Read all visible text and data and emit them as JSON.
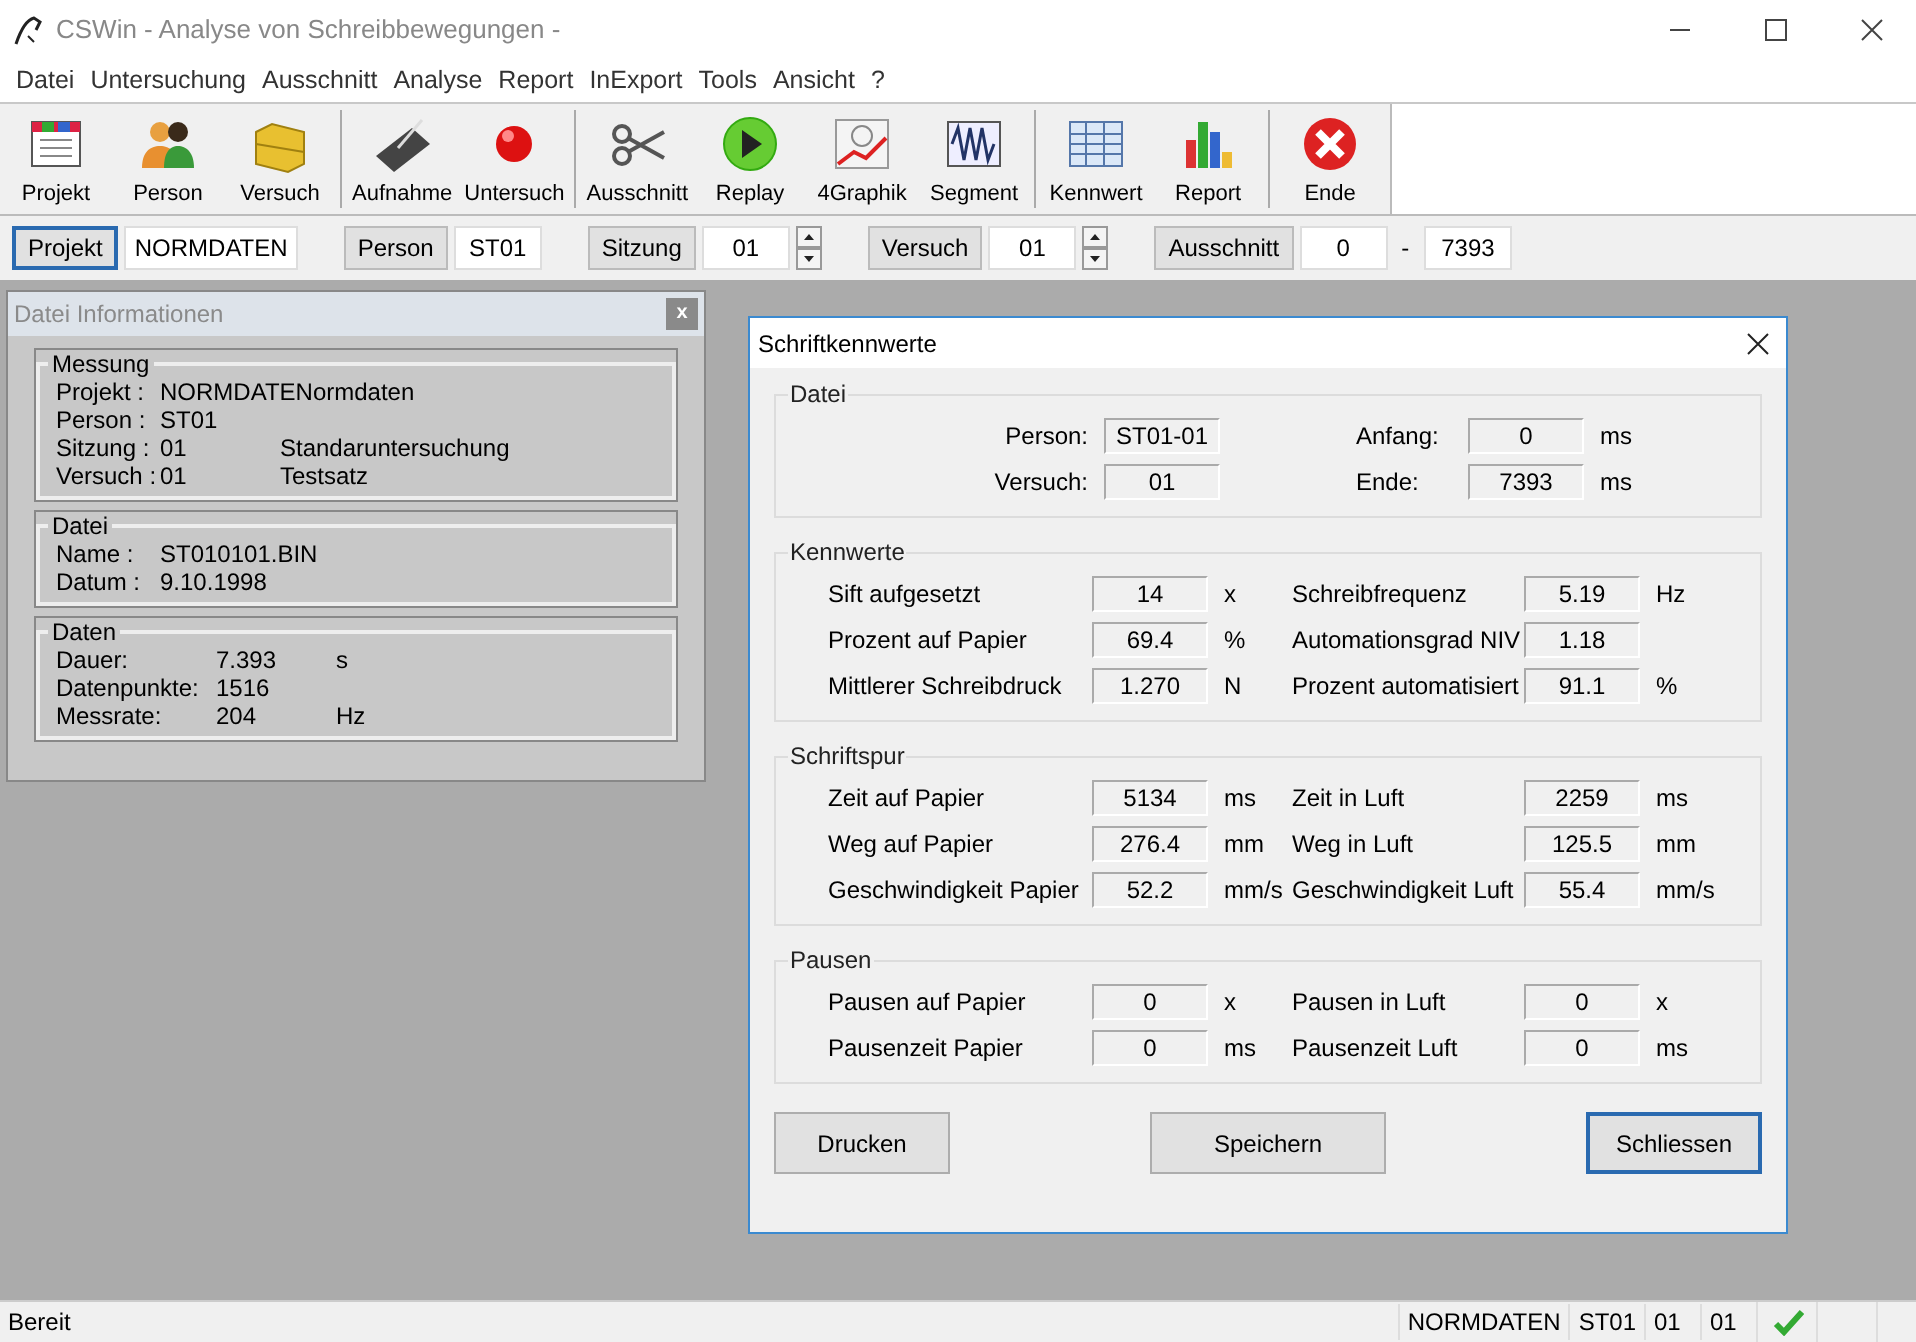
{
  "window": {
    "title": "CSWin - Analyse von Schreibbewegungen -"
  },
  "menu": [
    "Datei",
    "Untersuchung",
    "Ausschnitt",
    "Analyse",
    "Report",
    "InExport",
    "Tools",
    "Ansicht",
    "?"
  ],
  "toolbar": [
    [
      {
        "label": "Projekt",
        "kind": "document"
      },
      {
        "label": "Person",
        "kind": "people"
      },
      {
        "label": "Versuch",
        "kind": "folder"
      }
    ],
    [
      {
        "label": "Aufnahme",
        "kind": "tablet"
      },
      {
        "label": "Untersuch",
        "kind": "record"
      }
    ],
    [
      {
        "label": "Ausschnitt",
        "kind": "scissors"
      },
      {
        "label": "Replay",
        "kind": "play"
      },
      {
        "label": "4Graphik",
        "kind": "graph"
      },
      {
        "label": "Segment",
        "kind": "wave"
      }
    ],
    [
      {
        "label": "Kennwert",
        "kind": "table"
      },
      {
        "label": "Report",
        "kind": "bars"
      }
    ],
    [
      {
        "label": "Ende",
        "kind": "close"
      }
    ]
  ],
  "selector_bar": [
    {
      "button": "Projekt",
      "value": "NORMDATEN",
      "kind": "plain",
      "focused": true
    },
    {
      "button": "Person",
      "value": "ST01",
      "kind": "plain",
      "focused": false
    },
    {
      "button": "Sitzung",
      "value": "01",
      "kind": "spinner",
      "focused": false
    },
    {
      "button": "Versuch",
      "value": "01",
      "kind": "spinner",
      "focused": false
    },
    {
      "button": "Ausschnitt",
      "value": "0",
      "separator": "-",
      "value_end": "7393",
      "kind": "range",
      "focused": false
    }
  ],
  "info_panel": {
    "title": "Datei Informationen",
    "close": "x",
    "groups": [
      {
        "title": "Messung",
        "rows": [
          [
            "Projekt :",
            "NORMDATENormdaten"
          ],
          [
            "Person :",
            "ST01"
          ],
          [
            "Sitzung :",
            "01",
            "Standaruntersuchung"
          ],
          [
            "Versuch :",
            "01",
            "Testsatz"
          ]
        ]
      },
      {
        "title": "Datei",
        "rows": [
          [
            "Name :",
            "ST010101.BIN"
          ],
          [
            "Datum :",
            "9.10.1998"
          ]
        ]
      },
      {
        "title": "Daten",
        "rows": [
          [
            "Dauer:",
            "7.393",
            "s"
          ],
          [
            "Datenpunkte:",
            "1516"
          ],
          [
            "Messrate:",
            "204",
            "Hz"
          ]
        ]
      }
    ]
  },
  "dialog": {
    "title": "Schriftkennwerte",
    "sections": [
      {
        "title": "Datei",
        "kind": "compact",
        "rows": [
          [
            {
              "label": "Person:",
              "value": "ST01-01"
            },
            {
              "label": "Anfang:",
              "value": "0",
              "unit": "ms"
            }
          ],
          [
            {
              "label": "Versuch:",
              "value": "01"
            },
            {
              "label": "Ende:",
              "value": "7393",
              "unit": "ms"
            }
          ]
        ]
      },
      {
        "title": "Kennwerte",
        "kind": "wide",
        "rows": [
          [
            {
              "label": "Sift aufgesetzt",
              "value": "14",
              "unit": "x"
            },
            {
              "label": "Schreibfrequenz",
              "value": "5.19",
              "unit": "Hz"
            }
          ],
          [
            {
              "label": "Prozent auf Papier",
              "value": "69.4",
              "unit": "%"
            },
            {
              "label": "Automationsgrad NIV",
              "value": "1.18"
            }
          ],
          [
            {
              "label": "Mittlerer Schreibdruck",
              "value": "1.270",
              "unit": "N"
            },
            {
              "label": "Prozent automatisiert",
              "value": "91.1",
              "unit": "%"
            }
          ]
        ]
      },
      {
        "title": "Schriftspur",
        "kind": "wide",
        "rows": [
          [
            {
              "label": "Zeit auf Papier",
              "value": "5134",
              "unit": "ms"
            },
            {
              "label": "Zeit in Luft",
              "value": "2259",
              "unit": "ms"
            }
          ],
          [
            {
              "label": "Weg auf Papier",
              "value": "276.4",
              "unit": "mm"
            },
            {
              "label": "Weg in Luft",
              "value": "125.5",
              "unit": "mm"
            }
          ],
          [
            {
              "label": "Geschwindigkeit Papier",
              "value": "52.2",
              "unit": "mm/s"
            },
            {
              "label": "Geschwindigkeit Luft",
              "value": "55.4",
              "unit": "mm/s"
            }
          ]
        ]
      },
      {
        "title": "Pausen",
        "kind": "wide",
        "rows": [
          [
            {
              "label": "Pausen auf Papier",
              "value": "0",
              "unit": "x"
            },
            {
              "label": "Pausen in Luft",
              "value": "0",
              "unit": "x"
            }
          ],
          [
            {
              "label": "Pausenzeit Papier",
              "value": "0",
              "unit": "ms"
            },
            {
              "label": "Pausenzeit Luft",
              "value": "0",
              "unit": "ms"
            }
          ]
        ]
      }
    ],
    "buttons": [
      {
        "label": "Drucken",
        "default": false
      },
      {
        "label": "Speichern",
        "default": false
      },
      {
        "label": "Schliessen",
        "default": true
      }
    ]
  },
  "status_bar": {
    "message": "Bereit",
    "cells": [
      "NORMDATEN",
      "ST01",
      "01",
      "01"
    ],
    "ok": true
  }
}
